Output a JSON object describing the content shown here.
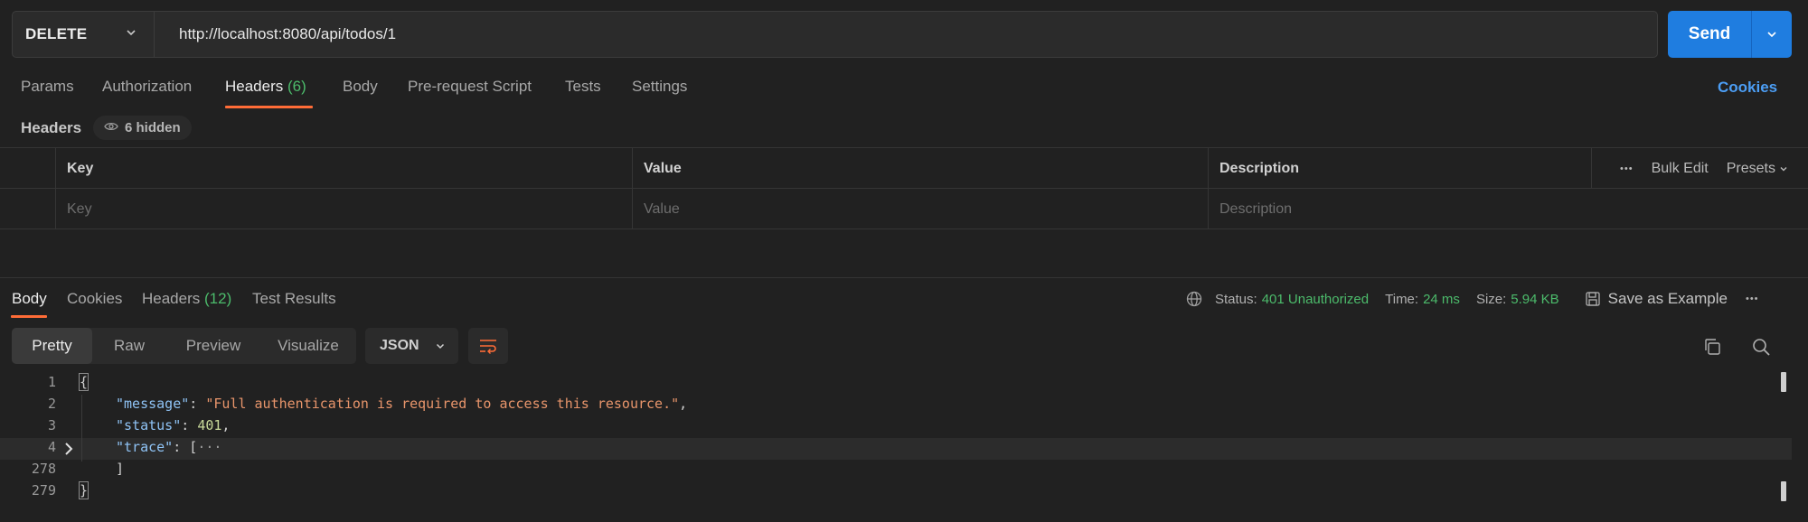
{
  "request": {
    "method": "DELETE",
    "url": "http://localhost:8080/api/todos/1",
    "send_label": "Send"
  },
  "request_tabs": {
    "params": "Params",
    "authorization": "Authorization",
    "headers": "Headers",
    "headers_count": "(6)",
    "body": "Body",
    "pre_request": "Pre-request Script",
    "tests": "Tests",
    "settings": "Settings",
    "cookies": "Cookies"
  },
  "headers_section": {
    "label": "Headers",
    "hidden_badge": "6 hidden",
    "columns": {
      "key": "Key",
      "value": "Value",
      "description": "Description"
    },
    "placeholders": {
      "key": "Key",
      "value": "Value",
      "description": "Description"
    },
    "more": "•••",
    "bulk_edit": "Bulk Edit",
    "presets": "Presets"
  },
  "response_tabs": {
    "body": "Body",
    "cookies": "Cookies",
    "headers": "Headers",
    "headers_count": "(12)",
    "test_results": "Test Results"
  },
  "response_meta": {
    "status_label": "Status:",
    "status_value": "401 Unauthorized",
    "time_label": "Time:",
    "time_value": "24 ms",
    "size_label": "Size:",
    "size_value": "5.94 KB",
    "save_example": "Save as Example",
    "more": "•••"
  },
  "view_modes": {
    "pretty": "Pretty",
    "raw": "Raw",
    "preview": "Preview",
    "visualize": "Visualize",
    "format": "JSON"
  },
  "code": {
    "line_numbers": [
      "1",
      "2",
      "3",
      "4",
      "278",
      "279"
    ],
    "open_brace": "{",
    "close_brace": "}",
    "message_key": "\"message\"",
    "message_value": "\"Full authentication is required to access this resource.\"",
    "status_key": "\"status\"",
    "status_value": "401",
    "trace_key": "\"trace\"",
    "trace_open": "[",
    "trace_collapsed": "···",
    "trace_close": "]",
    "colon": ": ",
    "comma": ","
  },
  "colors": {
    "accent_orange": "#ff6c37",
    "send_blue": "#1f7de0",
    "status_green": "#4cbb6b",
    "link_blue": "#4c9ef5"
  }
}
